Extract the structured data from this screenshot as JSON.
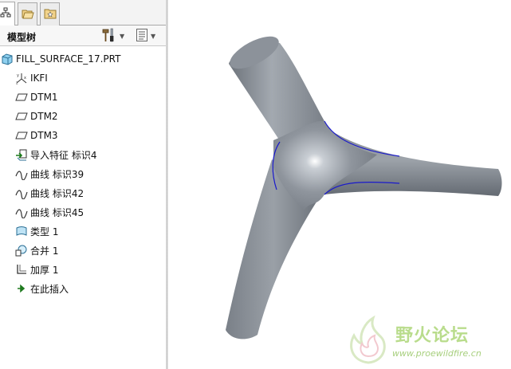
{
  "tabs": [
    {
      "name": "model-tree-tab",
      "icon": "model-tree-icon"
    },
    {
      "name": "folder-browser-tab",
      "icon": "folder-icon"
    },
    {
      "name": "favorites-tab",
      "icon": "favorites-icon"
    }
  ],
  "panel": {
    "title": "模型树",
    "settings_icon": "hammer-settings-icon",
    "show_icon": "tree-list-icon"
  },
  "tree": {
    "root": {
      "label": "FILL_SURFACE_17.PRT",
      "icon": "part-icon"
    },
    "items": [
      {
        "label": "IKFI",
        "icon": "coordinate-system-icon"
      },
      {
        "label": "DTM1",
        "icon": "datum-plane-icon"
      },
      {
        "label": "DTM2",
        "icon": "datum-plane-icon"
      },
      {
        "label": "DTM3",
        "icon": "datum-plane-icon"
      },
      {
        "label": "导入特征 标识4",
        "icon": "import-feature-icon"
      },
      {
        "label": "曲线 标识39",
        "icon": "curve-icon"
      },
      {
        "label": "曲线 标识42",
        "icon": "curve-icon"
      },
      {
        "label": "曲线 标识45",
        "icon": "curve-icon"
      },
      {
        "label": "类型 1",
        "icon": "boundary-blend-icon"
      },
      {
        "label": "合并 1",
        "icon": "merge-icon"
      },
      {
        "label": "加厚 1",
        "icon": "thicken-icon"
      },
      {
        "label": "在此插入",
        "icon": "insert-here-arrow-icon"
      }
    ]
  },
  "colors": {
    "model_fill": "#8a9099",
    "model_edge": "#1a1acc",
    "watermark_green": "#b9dc8c"
  },
  "watermark": {
    "title": "野火论坛",
    "url": "www.proewildfire.cn"
  }
}
